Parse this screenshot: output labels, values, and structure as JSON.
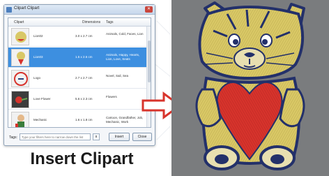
{
  "dialog": {
    "title": "Clipart Clipart",
    "close_glyph": "✕",
    "columns": [
      "Clipart",
      "Dimensions",
      "Tags"
    ],
    "rows": [
      {
        "name": "Lion02",
        "dimensions": "3.0 x 2.7 cm",
        "tags": "Animals, Cold, Faces, Lion",
        "selected": false
      },
      {
        "name": "Lion03",
        "dimensions": "1.5 x 2.6 cm",
        "tags": "Animals, Happy, Hearts, Lion, Love, Seats",
        "selected": true
      },
      {
        "name": "Logo",
        "dimensions": "2.7 x 2.7 cm",
        "tags": "Novel, Sail, Sea",
        "selected": false
      },
      {
        "name": "Love Flower",
        "dimensions": "5.6 x 2.3 cm",
        "tags": "Flowers",
        "selected": false
      },
      {
        "name": "Mechanic",
        "dimensions": "1.6 x 1.8 cm",
        "tags": "Cartoon, Grandfather, Job, Mechanic, Work",
        "selected": false
      }
    ],
    "tags_label": "Tags:",
    "tags_placeholder": "Type your filters here to narrow down the list",
    "small_button": "x",
    "insert_label": "Insert",
    "close_label": "Close"
  },
  "caption": "Insert Clipart",
  "colors": {
    "selection": "#3d8fe0",
    "arrow": "#d8342c",
    "embroidery_bg": "#7a7c7e",
    "thread_yellow": "#d9c866",
    "thread_red": "#d7332c",
    "thread_navy": "#23306a"
  }
}
